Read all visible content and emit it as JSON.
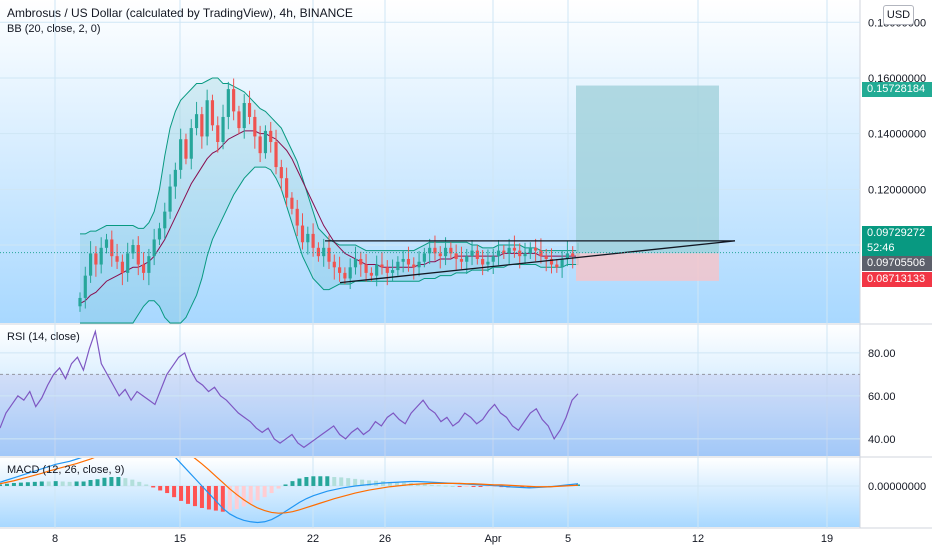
{
  "header": {
    "title": "Ambrosus / US Dollar (calculated by TradingView), 4h, BINANCE",
    "indicator": "BB (20, close, 2, 0)",
    "currency_button": "USD"
  },
  "panes": {
    "rsi_title": "RSI (14, close)",
    "macd_title": "MACD (12, 26, close, 9)"
  },
  "price_tags": {
    "target": "0.15728184",
    "current": "0.09729272",
    "countdown": "52:46",
    "entry": "0.09705506",
    "stop": "0.08713133"
  },
  "colors": {
    "up": "#26a69a",
    "down": "#ef5350",
    "bb_band": "#089981",
    "bb_basis": "#880e4f",
    "rsi": "#7e57c2",
    "macd": "#2196f3",
    "signal": "#ff6d00",
    "target_zone": "#9ccfd8",
    "stop_zone": "#f7c3c8"
  },
  "chart_data": [
    {
      "type": "line",
      "name": "price",
      "ylim": [
        0.072,
        0.188
      ],
      "y_ticks": [
        "0.18000000",
        "0.16000000",
        "0.14000000",
        "0.12000000",
        "0.10000000"
      ],
      "x_ticks": [
        "8",
        "15",
        "22",
        "26",
        "Apr",
        "5",
        "12",
        "19"
      ],
      "close": [
        0.081,
        0.089,
        0.097,
        0.093,
        0.099,
        0.102,
        0.096,
        0.094,
        0.09,
        0.097,
        0.1,
        0.093,
        0.09,
        0.096,
        0.102,
        0.106,
        0.112,
        0.121,
        0.127,
        0.138,
        0.131,
        0.142,
        0.147,
        0.139,
        0.152,
        0.143,
        0.137,
        0.146,
        0.156,
        0.148,
        0.142,
        0.151,
        0.146,
        0.139,
        0.133,
        0.141,
        0.137,
        0.128,
        0.124,
        0.117,
        0.113,
        0.107,
        0.101,
        0.104,
        0.099,
        0.096,
        0.099,
        0.094,
        0.092,
        0.09,
        0.088,
        0.092,
        0.095,
        0.093,
        0.09,
        0.089,
        0.093,
        0.092,
        0.09,
        0.091,
        0.094,
        0.095,
        0.093,
        0.092,
        0.094,
        0.097,
        0.099,
        0.097,
        0.096,
        0.099,
        0.097,
        0.095,
        0.094,
        0.096,
        0.098,
        0.095,
        0.093,
        0.094,
        0.096,
        0.098,
        0.097,
        0.099,
        0.098,
        0.096,
        0.097,
        0.099,
        0.098,
        0.096,
        0.095,
        0.093,
        0.092,
        0.095,
        0.097,
        0.096,
        0.097
      ],
      "upper": [
        0.104,
        0.104,
        0.105,
        0.105,
        0.106,
        0.107,
        0.107,
        0.107,
        0.107,
        0.107,
        0.107,
        0.106,
        0.106,
        0.108,
        0.112,
        0.12,
        0.132,
        0.142,
        0.148,
        0.152,
        0.154,
        0.156,
        0.158,
        0.158,
        0.159,
        0.16,
        0.16,
        0.158,
        0.158,
        0.157,
        0.156,
        0.155,
        0.153,
        0.151,
        0.149,
        0.148,
        0.146,
        0.144,
        0.142,
        0.138,
        0.134,
        0.13,
        0.124,
        0.118,
        0.112,
        0.106,
        0.104,
        0.102,
        0.101,
        0.1,
        0.1,
        0.1,
        0.1,
        0.099,
        0.098,
        0.098,
        0.098,
        0.098,
        0.098,
        0.098,
        0.098,
        0.098,
        0.098,
        0.098,
        0.099,
        0.1,
        0.101,
        0.101,
        0.101,
        0.101,
        0.101,
        0.101,
        0.101,
        0.101,
        0.1,
        0.1,
        0.099,
        0.099,
        0.099,
        0.1,
        0.1,
        0.1,
        0.1,
        0.1,
        0.099,
        0.099,
        0.099,
        0.098,
        0.098,
        0.098,
        0.098,
        0.098,
        0.098,
        0.098,
        0.098
      ],
      "basis": [
        0.079,
        0.08,
        0.082,
        0.083,
        0.085,
        0.087,
        0.088,
        0.089,
        0.09,
        0.091,
        0.092,
        0.092,
        0.093,
        0.094,
        0.096,
        0.099,
        0.102,
        0.106,
        0.11,
        0.114,
        0.118,
        0.122,
        0.125,
        0.128,
        0.131,
        0.133,
        0.134,
        0.136,
        0.138,
        0.139,
        0.14,
        0.141,
        0.141,
        0.141,
        0.14,
        0.14,
        0.139,
        0.138,
        0.136,
        0.134,
        0.131,
        0.127,
        0.123,
        0.119,
        0.115,
        0.111,
        0.107,
        0.104,
        0.101,
        0.099,
        0.097,
        0.096,
        0.095,
        0.094,
        0.093,
        0.093,
        0.093,
        0.092,
        0.092,
        0.092,
        0.092,
        0.092,
        0.092,
        0.092,
        0.093,
        0.093,
        0.094,
        0.094,
        0.095,
        0.095,
        0.095,
        0.096,
        0.096,
        0.096,
        0.096,
        0.096,
        0.096,
        0.096,
        0.096,
        0.096,
        0.097,
        0.097,
        0.097,
        0.097,
        0.097,
        0.097,
        0.097,
        0.096,
        0.096,
        0.096,
        0.096,
        0.096,
        0.096,
        0.096,
        0.096
      ],
      "lower": [
        0.072,
        0.072,
        0.072,
        0.072,
        0.072,
        0.072,
        0.072,
        0.072,
        0.072,
        0.072,
        0.072,
        0.075,
        0.078,
        0.08,
        0.08,
        0.078,
        0.074,
        0.072,
        0.072,
        0.072,
        0.074,
        0.078,
        0.082,
        0.088,
        0.096,
        0.102,
        0.106,
        0.11,
        0.114,
        0.118,
        0.121,
        0.124,
        0.126,
        0.128,
        0.128,
        0.128,
        0.127,
        0.124,
        0.12,
        0.114,
        0.108,
        0.102,
        0.096,
        0.092,
        0.088,
        0.086,
        0.084,
        0.084,
        0.085,
        0.086,
        0.086,
        0.086,
        0.087,
        0.087,
        0.087,
        0.087,
        0.087,
        0.087,
        0.087,
        0.087,
        0.087,
        0.087,
        0.087,
        0.087,
        0.087,
        0.088,
        0.088,
        0.088,
        0.089,
        0.089,
        0.089,
        0.09,
        0.09,
        0.09,
        0.091,
        0.091,
        0.091,
        0.091,
        0.092,
        0.092,
        0.092,
        0.093,
        0.093,
        0.093,
        0.093,
        0.093,
        0.093,
        0.092,
        0.092,
        0.092,
        0.092,
        0.092,
        0.093,
        0.093,
        0.093
      ],
      "position": {
        "target": 0.15728184,
        "entry": 0.09705506,
        "stop": 0.08713133
      },
      "triangle_top": 0.1015,
      "triangle_bottom_start": 0.0865
    },
    {
      "type": "line",
      "name": "RSI (14, close)",
      "ylim": [
        32,
        93
      ],
      "y_ticks": [
        "80.00",
        "60.00",
        "40.00"
      ],
      "band": [
        30,
        70
      ],
      "values": [
        45,
        52,
        56,
        60,
        58,
        62,
        55,
        59,
        65,
        70,
        73,
        68,
        75,
        78,
        72,
        82,
        90,
        75,
        70,
        65,
        60,
        63,
        58,
        62,
        60,
        58,
        56,
        63,
        70,
        74,
        78,
        80,
        72,
        67,
        65,
        62,
        64,
        60,
        58,
        55,
        52,
        50,
        48,
        45,
        43,
        45,
        40,
        38,
        40,
        42,
        38,
        36,
        38,
        40,
        42,
        44,
        46,
        42,
        40,
        43,
        45,
        42,
        44,
        48,
        46,
        50,
        52,
        49,
        47,
        52,
        55,
        58,
        54,
        52,
        48,
        50,
        46,
        48,
        52,
        50,
        47,
        49,
        53,
        56,
        52,
        50,
        46,
        44,
        48,
        52,
        54,
        49,
        46,
        40,
        44,
        50,
        58,
        61
      ]
    },
    {
      "type": "bar",
      "name": "MACD (12, 26, close, 9)",
      "ylim": [
        -0.011,
        0.0075
      ],
      "y_ticks": [
        "0.00000000"
      ],
      "macd": [
        0.001,
        0.0016,
        0.0022,
        0.0028,
        0.0034,
        0.004,
        0.0046,
        0.0052,
        0.0058,
        0.0062,
        0.0066,
        0.0072,
        0.0078,
        0.0088,
        0.0098,
        0.011,
        0.012,
        0.0128,
        0.0132,
        0.0134,
        0.0132,
        0.0128,
        0.012,
        0.011,
        0.0098,
        0.008,
        0.006,
        0.004,
        0.002,
        0.0,
        -0.002,
        -0.004,
        -0.006,
        -0.0075,
        -0.0085,
        -0.0092,
        -0.0096,
        -0.0098,
        -0.0096,
        -0.009,
        -0.008,
        -0.0068,
        -0.0056,
        -0.0044,
        -0.0034,
        -0.0026,
        -0.002,
        -0.0014,
        -0.001,
        -0.0006,
        -0.0003,
        0.0,
        0.0002,
        0.0004,
        0.0006,
        0.0008,
        0.0009,
        0.001,
        0.0011,
        0.0012,
        0.0012,
        0.0011,
        0.001,
        0.0009,
        0.0008,
        0.0007,
        0.0006,
        0.0005,
        0.0004,
        0.0003,
        0.0002,
        0.0001,
        0.0,
        -0.0002,
        -0.0003,
        -0.0004,
        -0.0005,
        -0.0004,
        -0.0003,
        -0.0002,
        0.0,
        0.0002,
        0.0004,
        0.0006
      ],
      "signal": [
        0.0006,
        0.001,
        0.0014,
        0.0019,
        0.0024,
        0.0029,
        0.0034,
        0.004,
        0.0045,
        0.005,
        0.0055,
        0.006,
        0.0066,
        0.0072,
        0.008,
        0.0088,
        0.0096,
        0.0104,
        0.0111,
        0.0117,
        0.0121,
        0.0124,
        0.0124,
        0.0122,
        0.0117,
        0.011,
        0.01,
        0.0088,
        0.0074,
        0.0059,
        0.0043,
        0.0026,
        0.0009,
        -0.0008,
        -0.0023,
        -0.0037,
        -0.0049,
        -0.0059,
        -0.0066,
        -0.0071,
        -0.0073,
        -0.0072,
        -0.0069,
        -0.0064,
        -0.0058,
        -0.0052,
        -0.0046,
        -0.004,
        -0.0034,
        -0.0029,
        -0.0024,
        -0.0019,
        -0.0015,
        -0.0011,
        -0.0008,
        -0.0005,
        -0.0002,
        0.0,
        0.0002,
        0.0004,
        0.0005,
        0.0006,
        0.0007,
        0.0007,
        0.0007,
        0.0007,
        0.0007,
        0.0006,
        0.0006,
        0.0005,
        0.0004,
        0.0003,
        0.0003,
        0.0002,
        0.0001,
        0.0,
        -0.0001,
        -0.0002,
        -0.0002,
        -0.0002,
        -0.0001,
        0.0,
        0.0001,
        0.0002
      ]
    }
  ]
}
